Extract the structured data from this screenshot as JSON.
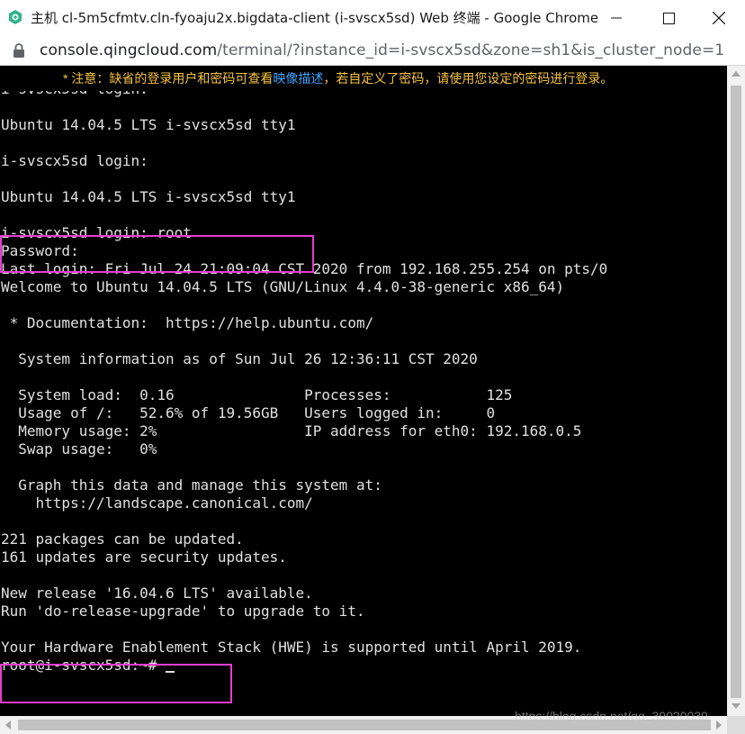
{
  "window": {
    "title": "主机 cl-5m5cfmtv.cln-fyoaju2x.bigdata-client (i-svscx5sd) Web 终端 - Google Chrome",
    "app_icon": "qingcloud-logo-icon",
    "controls": {
      "minimize": "minimize-icon",
      "maximize": "maximize-icon",
      "close": "close-icon"
    }
  },
  "address": {
    "host": "console.qingcloud.com",
    "path": "/terminal/?instance_id=i-svscx5sd&zone=sh1&is_cluster_node=1",
    "icon": "lock-icon"
  },
  "notice": {
    "prefix": "* 注意：缺省的登录用户和密码可查看",
    "link": "映像描述",
    "suffix": "，若自定义了密码，请使用您设定的密码进行登录。"
  },
  "terminal": {
    "lines": [
      "Ubuntu 14.04.5 LTS i-svscx5sd tty1",
      "i-svscx5sd login:",
      "",
      "Ubuntu 14.04.5 LTS i-svscx5sd tty1",
      "",
      "i-svscx5sd login:",
      "",
      "Ubuntu 14.04.5 LTS i-svscx5sd tty1",
      "",
      "i-svscx5sd login: root",
      "Password:",
      "Last login: Fri Jul 24 21:09:04 CST 2020 from 192.168.255.254 on pts/0",
      "Welcome to Ubuntu 14.04.5 LTS (GNU/Linux 4.4.0-38-generic x86_64)",
      "",
      " * Documentation:  https://help.ubuntu.com/",
      "",
      "  System information as of Sun Jul 26 12:36:11 CST 2020",
      "",
      "  System load:  0.16               Processes:           125",
      "  Usage of /:   52.6% of 19.56GB   Users logged in:     0",
      "  Memory usage: 2%                 IP address for eth0: 192.168.0.5",
      "  Swap usage:   0%",
      "",
      "  Graph this data and manage this system at:",
      "    https://landscape.canonical.com/",
      "",
      "221 packages can be updated.",
      "161 updates are security updates.",
      "",
      "New release '16.04.6 LTS' available.",
      "Run 'do-release-upgrade' to upgrade to it.",
      "",
      "Your Hardware Enablement Stack (HWE) is supported until April 2019."
    ],
    "prompt": "root@i-svscx5sd:~# "
  },
  "watermark": "https://blog.csdn.net/qq_39020039",
  "colors": {
    "terminal_bg": "#000000",
    "terminal_fg": "#e0e0e0",
    "notice_fg": "#f5c242",
    "link": "#3ea3ff",
    "highlight": "#e83ccf"
  }
}
